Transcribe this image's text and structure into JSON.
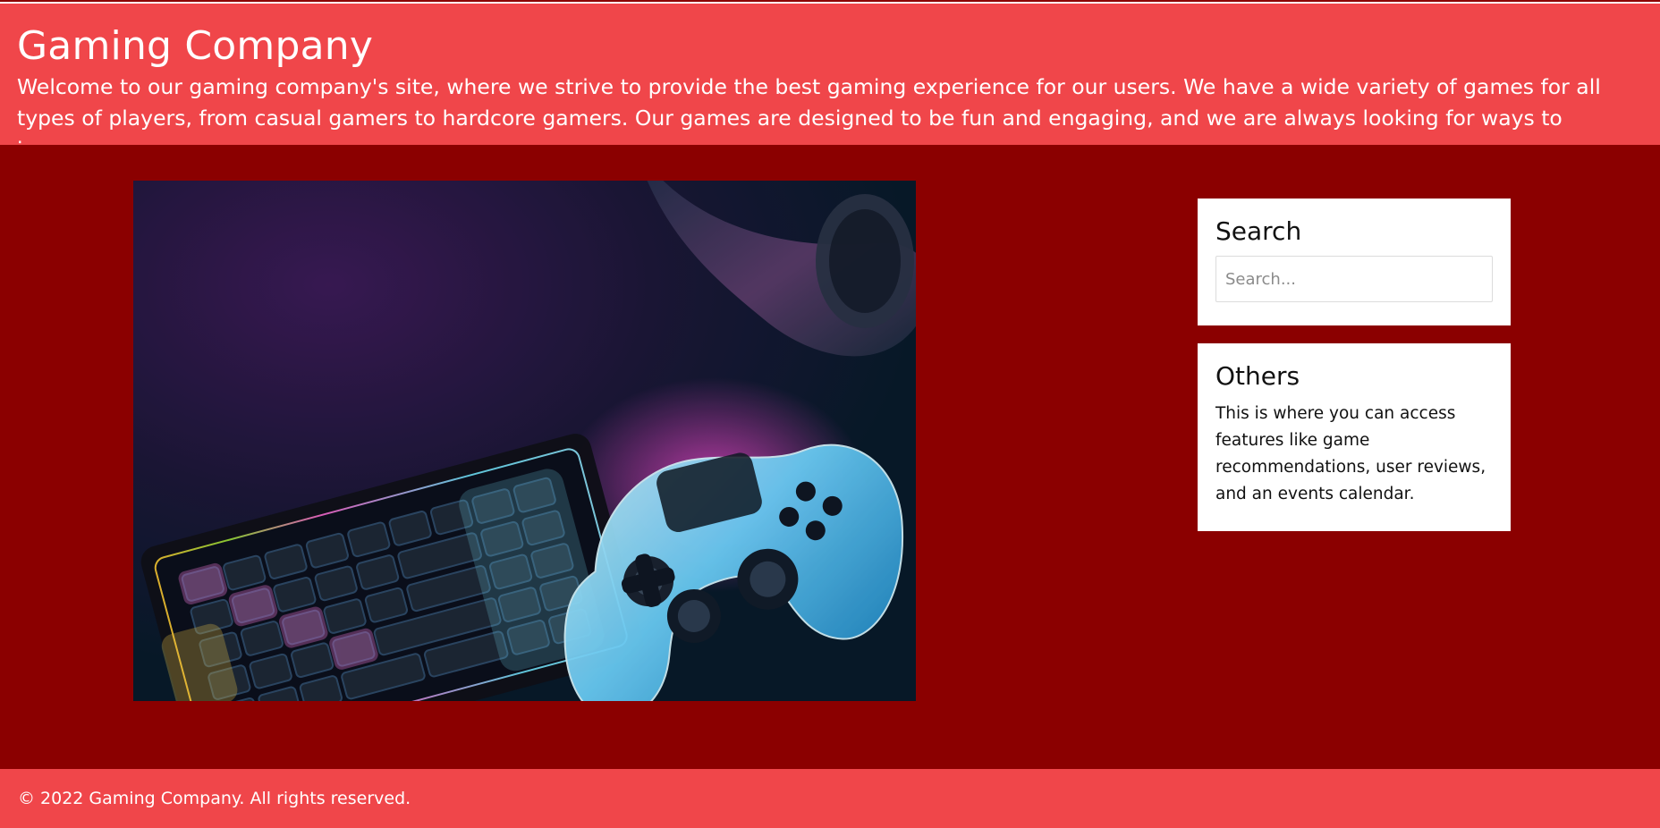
{
  "header": {
    "title": "Gaming Company",
    "intro": "Welcome to our gaming company's site, where we strive to provide the best gaming experience for our users. We have a wide variety of games for all types of players, from casual gamers to hardcore gamers. Our games are designed to be fun and engaging, and we are always looking for ways to improve our games."
  },
  "hero": {
    "image_name": "keyboard-and-controller-image"
  },
  "sidebar": {
    "search": {
      "title": "Search",
      "placeholder": "Search..."
    },
    "others": {
      "title": "Others",
      "body": "This is where you can access features like game recommendations, user reviews, and an events calendar."
    }
  },
  "footer": {
    "copyright": "© 2022 Gaming Company. All rights reserved."
  },
  "colors": {
    "header_bg": "#f0464a",
    "main_bg": "#8b0000",
    "footer_bg": "#f0464a",
    "widget_bg": "#ffffff"
  }
}
